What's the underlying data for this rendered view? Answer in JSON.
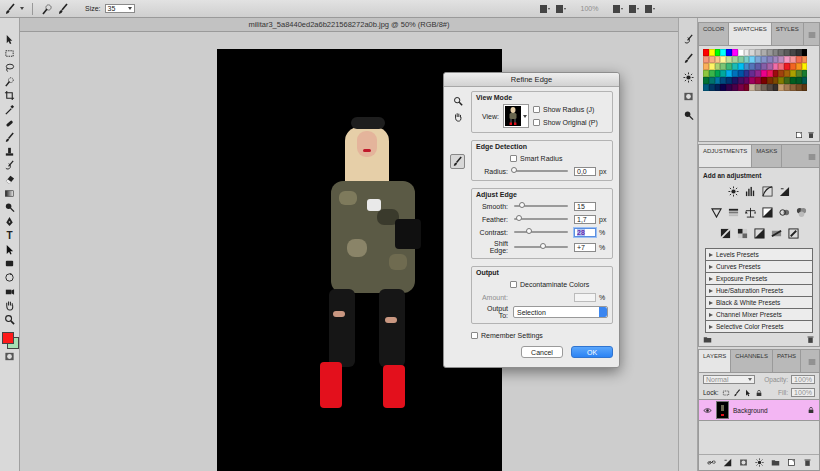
{
  "window": {
    "title": "militar3_5a8440ed2a6b221568272a0b.jpg @ 50% (RGB/8#)"
  },
  "options_bar": {
    "size_label": "Size:",
    "size_value": "35",
    "zoom": {
      "text": "100%",
      "disabled": true
    }
  },
  "toolbar": {
    "type_glyph": "T",
    "foreground": "#ff1a1a",
    "background": "#a7e0b4"
  },
  "dialog": {
    "title": "Refine Edge",
    "view_mode": {
      "heading": "View Mode",
      "view_label": "View:",
      "options": [
        {
          "label": "Show Radius (J)",
          "checked": false
        },
        {
          "label": "Show Original (P)",
          "checked": false
        }
      ]
    },
    "edge_detection": {
      "heading": "Edge Detection",
      "smart_radius": {
        "label": "Smart Radius",
        "checked": false
      },
      "radius": {
        "label": "Radius:",
        "value": "0,0",
        "unit": "px",
        "level": 0
      }
    },
    "adjust_edge": {
      "heading": "Adjust Edge",
      "sliders": [
        {
          "label": "Smooth:",
          "value": "15",
          "level": 0.15,
          "focused": false
        },
        {
          "label": "Feather:",
          "value": "1,7",
          "unit": "px",
          "level": 0.1,
          "focused": false
        },
        {
          "label": "Contrast:",
          "value": "28",
          "unit": "%",
          "level": 0.28,
          "focused": true
        },
        {
          "label": "Shift Edge:",
          "value": "+7",
          "unit": "%",
          "level": 0.535,
          "focused": false
        }
      ]
    },
    "output": {
      "heading": "Output",
      "decontaminate": {
        "label": "Decontaminate Colors",
        "checked": false
      },
      "amount": {
        "label": "Amount:",
        "unit": "%",
        "disabled": true
      },
      "output_to": {
        "label": "Output To:",
        "value": "Selection"
      }
    },
    "remember": {
      "label": "Remember Settings",
      "checked": false
    },
    "buttons": [
      {
        "label": "Cancel",
        "default": false
      },
      {
        "label": "OK",
        "default": true
      }
    ]
  },
  "swatches_panel": {
    "tabs": [
      {
        "label": "COLOR",
        "selected": false
      },
      {
        "label": "SWATCHES",
        "selected": true
      },
      {
        "label": "STYLES",
        "selected": false
      }
    ],
    "swatches": [
      {
        "color": "#ff0000"
      },
      {
        "color": "#ffff00"
      },
      {
        "color": "#00ff00"
      },
      {
        "color": "#00ffff"
      },
      {
        "color": "#0000ff"
      },
      {
        "color": "#ff00ff"
      },
      {
        "color": "#ffffff"
      },
      {
        "color": "#ebebeb"
      },
      {
        "color": "#d6d6d6"
      },
      {
        "color": "#c2c2c2"
      },
      {
        "color": "#adadad"
      },
      {
        "color": "#999999"
      },
      {
        "color": "#858585"
      },
      {
        "color": "#707070"
      },
      {
        "color": "#5c5c5c"
      },
      {
        "color": "#474747"
      },
      {
        "color": "#333333"
      },
      {
        "color": "#000000"
      },
      {
        "color": "#f7977a"
      },
      {
        "color": "#f9ad81"
      },
      {
        "color": "#fdc68a"
      },
      {
        "color": "#fff79a"
      },
      {
        "color": "#c4df9b"
      },
      {
        "color": "#a2d39c"
      },
      {
        "color": "#82ca9d"
      },
      {
        "color": "#7bcdc8"
      },
      {
        "color": "#6ecff6"
      },
      {
        "color": "#7ea7d8"
      },
      {
        "color": "#8493ca"
      },
      {
        "color": "#8882be"
      },
      {
        "color": "#a187be"
      },
      {
        "color": "#bc8dbf"
      },
      {
        "color": "#f49ac2"
      },
      {
        "color": "#f6989d"
      },
      {
        "color": "#f26c4f"
      },
      {
        "color": "#f68e55"
      },
      {
        "color": "#fbaf5c"
      },
      {
        "color": "#fff467"
      },
      {
        "color": "#acd372"
      },
      {
        "color": "#7cc576"
      },
      {
        "color": "#3bb878"
      },
      {
        "color": "#1abbb4"
      },
      {
        "color": "#00bff3"
      },
      {
        "color": "#438cca"
      },
      {
        "color": "#5574b9"
      },
      {
        "color": "#605ca8"
      },
      {
        "color": "#855fa8"
      },
      {
        "color": "#a763a8"
      },
      {
        "color": "#f06ea9"
      },
      {
        "color": "#f26d7d"
      },
      {
        "color": "#ed1c24"
      },
      {
        "color": "#f26522"
      },
      {
        "color": "#f7941d"
      },
      {
        "color": "#fff200"
      },
      {
        "color": "#8dc73f"
      },
      {
        "color": "#39b54a"
      },
      {
        "color": "#00a651"
      },
      {
        "color": "#00a99d"
      },
      {
        "color": "#00aeef"
      },
      {
        "color": "#0072bc"
      },
      {
        "color": "#0054a6"
      },
      {
        "color": "#2e3192"
      },
      {
        "color": "#662d91"
      },
      {
        "color": "#92278f"
      },
      {
        "color": "#ec008c"
      },
      {
        "color": "#ed145b"
      },
      {
        "color": "#9e0b0f"
      },
      {
        "color": "#a0410d"
      },
      {
        "color": "#a36209"
      },
      {
        "color": "#aba000"
      },
      {
        "color": "#598527"
      },
      {
        "color": "#1a7b30"
      },
      {
        "color": "#007236"
      },
      {
        "color": "#00746b"
      },
      {
        "color": "#0076a3"
      },
      {
        "color": "#004b80"
      },
      {
        "color": "#003471"
      },
      {
        "color": "#1b1464"
      },
      {
        "color": "#440e62"
      },
      {
        "color": "#630460"
      },
      {
        "color": "#9e005d"
      },
      {
        "color": "#9e0039"
      },
      {
        "color": "#790000"
      },
      {
        "color": "#7b2e00"
      },
      {
        "color": "#7d4900"
      },
      {
        "color": "#827b00"
      },
      {
        "color": "#406618"
      },
      {
        "color": "#005e20"
      },
      {
        "color": "#005826"
      },
      {
        "color": "#005952"
      },
      {
        "color": "#005b7f"
      },
      {
        "color": "#003663"
      },
      {
        "color": "#002157"
      },
      {
        "color": "#0d004c"
      },
      {
        "color": "#32004b"
      },
      {
        "color": "#4b0049"
      },
      {
        "color": "#7b0046"
      },
      {
        "color": "#7a0026"
      },
      {
        "color": "#c7b299"
      },
      {
        "color": "#998675"
      },
      {
        "color": "#736357"
      },
      {
        "color": "#534741"
      },
      {
        "color": "#37302d"
      },
      {
        "color": "#c69c6d"
      },
      {
        "color": "#a67c52"
      },
      {
        "color": "#8c6239"
      },
      {
        "color": "#754c24"
      },
      {
        "color": "#603913"
      }
    ]
  },
  "adjustments_panel": {
    "tabs": [
      {
        "label": "ADJUSTMENTS",
        "selected": true
      },
      {
        "label": "MASKS",
        "selected": false
      }
    ],
    "hint": "Add an adjustment",
    "presets": [
      {
        "label": "Levels Presets"
      },
      {
        "label": "Curves Presets"
      },
      {
        "label": "Exposure Presets"
      },
      {
        "label": "Hue/Saturation Presets"
      },
      {
        "label": "Black & White Presets"
      },
      {
        "label": "Channel Mixer Presets"
      },
      {
        "label": "Selective Color Presets"
      }
    ]
  },
  "layers_panel": {
    "tabs": [
      {
        "label": "LAYERS",
        "selected": true
      },
      {
        "label": "CHANNELS",
        "selected": false
      },
      {
        "label": "PATHS",
        "selected": false
      }
    ],
    "blend_mode": {
      "value": "Normal",
      "disabled": true
    },
    "opacity": {
      "label": "Opacity:",
      "value": "100%",
      "disabled": true
    },
    "lock_label": "Lock:",
    "fill": {
      "label": "Fill:",
      "value": "100%",
      "disabled": true
    },
    "layers": [
      {
        "name": "Background",
        "selected": true,
        "visible": true,
        "locked": true
      }
    ]
  }
}
